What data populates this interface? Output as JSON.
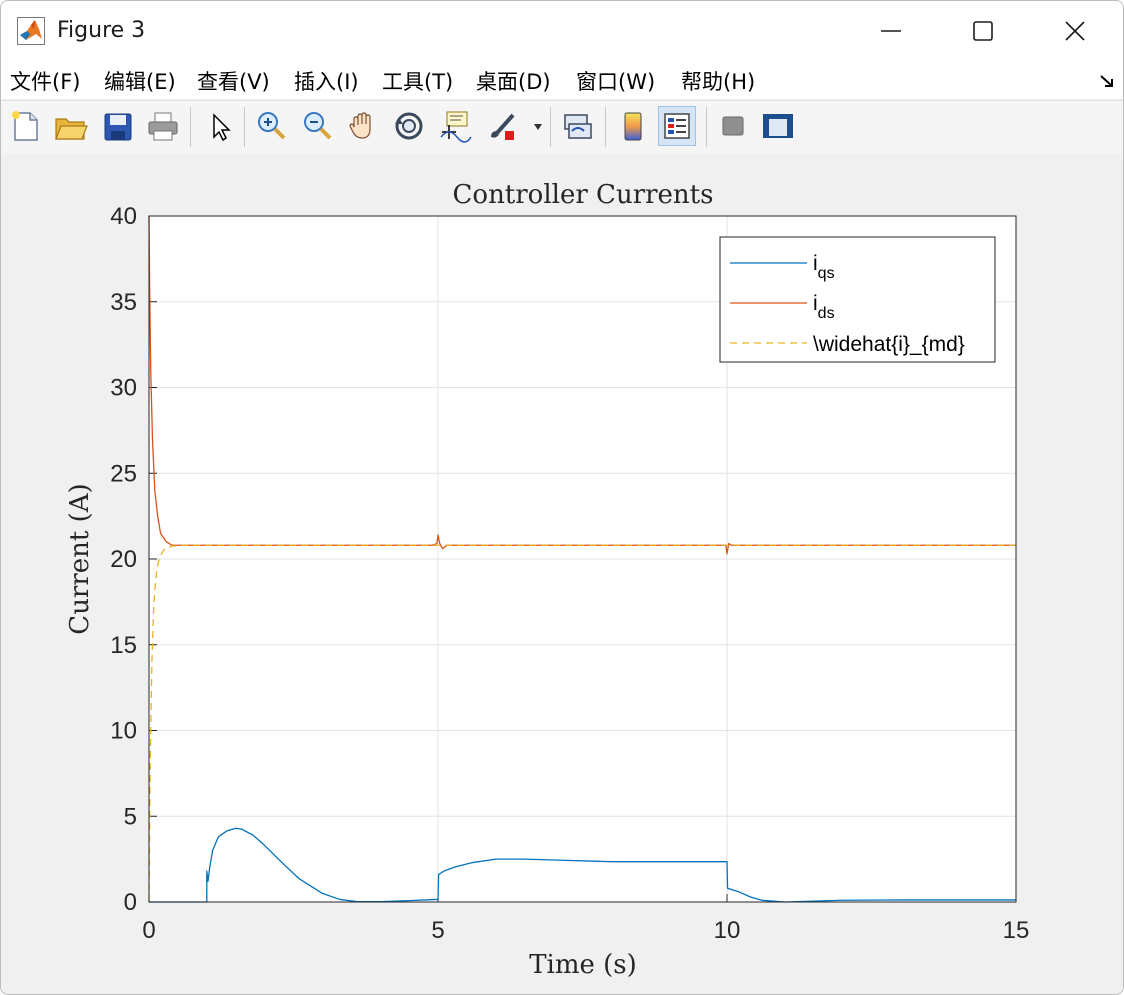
{
  "window": {
    "title": "Figure 3"
  },
  "menu": [
    "文件(F)",
    "编辑(E)",
    "查看(V)",
    "插入(I)",
    "工具(T)",
    "桌面(D)",
    "窗口(W)",
    "帮助(H)"
  ],
  "toolbar": {
    "icons": [
      "new-figure-icon",
      "open-file-icon",
      "save-icon",
      "print-icon",
      "pointer-icon",
      "zoom-in-icon",
      "zoom-out-icon",
      "pan-icon",
      "rotate-3d-icon",
      "data-cursor-icon",
      "brush-icon",
      "link-plot-icon",
      "colorbar-icon",
      "legend-icon",
      "hide-plot-tools-icon",
      "show-plot-tools-icon"
    ],
    "active": "legend-icon"
  },
  "chart_data": {
    "type": "line",
    "title": "Controller Currents",
    "xlabel": "Time (s)",
    "ylabel": "Current (A)",
    "xlim": [
      0,
      15
    ],
    "ylim": [
      0,
      40
    ],
    "xticks": [
      0,
      5,
      10,
      15
    ],
    "yticks": [
      0,
      5,
      10,
      15,
      20,
      25,
      30,
      35,
      40
    ],
    "grid": true,
    "legend_position": "top-right",
    "series": [
      {
        "name": "i_qs",
        "legend_main": "i",
        "legend_sub": "qs",
        "color": "#0072BD",
        "style": "solid",
        "x": [
          0,
          1.0,
          1.0,
          1.02,
          1.05,
          1.1,
          1.2,
          1.35,
          1.5,
          1.6,
          1.8,
          2.0,
          2.3,
          2.6,
          3.0,
          3.3,
          3.6,
          4.0,
          4.5,
          4.98,
          5.0,
          5.01,
          5.1,
          5.3,
          5.6,
          6.0,
          6.5,
          7.0,
          8.0,
          9.0,
          9.99,
          10.0,
          10.01,
          10.2,
          10.4,
          10.6,
          11.0,
          11.5,
          12.0,
          13.0,
          14.0,
          15.0
        ],
        "y": [
          0,
          0,
          1.8,
          1.2,
          2.0,
          3.0,
          3.8,
          4.15,
          4.3,
          4.25,
          3.9,
          3.3,
          2.3,
          1.35,
          0.5,
          0.15,
          0.02,
          0.02,
          0.08,
          0.15,
          0.15,
          1.6,
          1.8,
          2.05,
          2.3,
          2.5,
          2.5,
          2.45,
          2.35,
          2.35,
          2.35,
          2.35,
          0.8,
          0.6,
          0.3,
          0.1,
          0.0,
          0.05,
          0.1,
          0.12,
          0.12,
          0.12
        ]
      },
      {
        "name": "i_ds",
        "legend_main": "i",
        "legend_sub": "ds",
        "color": "#D95319",
        "style": "solid",
        "x": [
          0,
          0.01,
          0.03,
          0.06,
          0.1,
          0.15,
          0.2,
          0.3,
          0.4,
          0.6,
          1.0,
          2.0,
          4.9,
          4.98,
          5.0,
          5.03,
          5.08,
          5.15,
          6.0,
          9.9,
          9.98,
          10.0,
          10.03,
          10.08,
          10.15,
          12.0,
          15.0
        ],
        "y": [
          40,
          36,
          31,
          27,
          24,
          22.5,
          21.5,
          21.0,
          20.8,
          20.8,
          20.8,
          20.8,
          20.8,
          20.9,
          21.4,
          20.9,
          20.6,
          20.8,
          20.8,
          20.8,
          20.8,
          20.3,
          20.9,
          20.8,
          20.8,
          20.8,
          20.8
        ]
      },
      {
        "name": "\\widehat{i}_{md}",
        "legend_main": "\\widehat{i}_{md}",
        "legend_sub": "",
        "color": "#EDB120",
        "style": "dashed",
        "x": [
          0,
          0.02,
          0.05,
          0.08,
          0.1,
          0.13,
          0.16,
          0.2,
          0.25,
          0.3,
          0.4,
          0.6,
          1.0,
          5.0,
          10.0,
          15.0
        ],
        "y": [
          0,
          8,
          14,
          17,
          18.2,
          19.2,
          19.8,
          20.2,
          20.5,
          20.65,
          20.75,
          20.8,
          20.8,
          20.8,
          20.8,
          20.8
        ]
      }
    ]
  }
}
